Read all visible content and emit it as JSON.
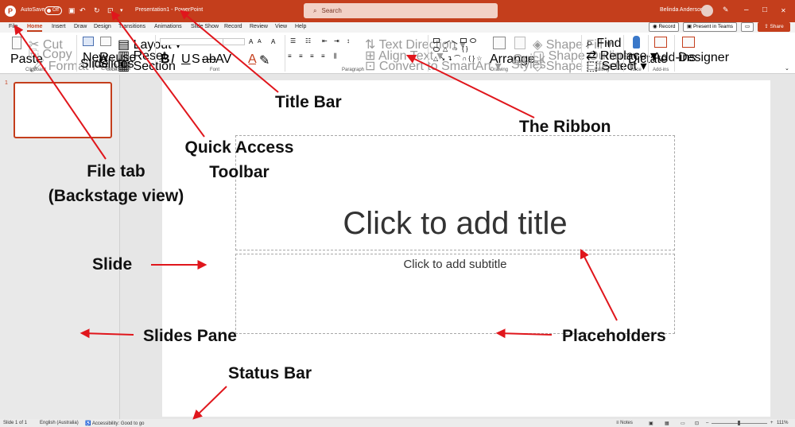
{
  "titlebar": {
    "logo": "P",
    "autosave_label": "AutoSave",
    "autosave_state": "Off",
    "qat": [
      "save-icon",
      "undo-icon",
      "redo-icon",
      "present-icon",
      "customize-icon"
    ],
    "doc_title": "Presentation1  -  PowerPoint",
    "search_placeholder": "Search",
    "user_name": "Belinda Anderson",
    "minimize": "–",
    "maximize": "□",
    "close": "✕"
  },
  "tabs": [
    "File",
    "Home",
    "Insert",
    "Draw",
    "Design",
    "Transitions",
    "Animations",
    "Slide Show",
    "Record",
    "Review",
    "View",
    "Help"
  ],
  "tab_right": {
    "record": "Record",
    "present": "Present in Teams",
    "share": "Share"
  },
  "ribbon": {
    "clipboard": {
      "group": "Clipboard",
      "paste": "Paste",
      "cut": "Cut",
      "copy": "Copy",
      "format_painter": "Format Painter"
    },
    "slides": {
      "group": "Slides",
      "new_slide_1": "New",
      "new_slide_2": "Slide",
      "reuse_1": "Reuse",
      "reuse_2": "Slides",
      "layout": "Layout",
      "reset": "Reset",
      "section": "Section"
    },
    "font": {
      "group": "Font",
      "bold": "B",
      "italic": "I",
      "underline": "U",
      "strike": "S",
      "shadow": "ab",
      "spacing": "AV",
      "grow": "A",
      "shrink": "A",
      "clear": "A"
    },
    "paragraph": {
      "group": "Paragraph",
      "text_direction": "Text Direction",
      "align_text": "Align Text",
      "smartart": "Convert to SmartArt"
    },
    "drawing": {
      "group": "Drawing",
      "arrange": "Arrange",
      "quick_styles_1": "Quick",
      "quick_styles_2": "Styles",
      "shape_fill": "Shape Fill",
      "shape_outline": "Shape Outline",
      "shape_effects": "Shape Effects"
    },
    "editing": {
      "group": "Editing",
      "find": "Find",
      "replace": "Replace",
      "select": "Select"
    },
    "voice": {
      "group": "Voice",
      "dictate": "Dictate"
    },
    "addins": {
      "group": "Add-ins",
      "addins": "Add-ins"
    },
    "designer": {
      "designer": "Designer"
    }
  },
  "slides_pane": {
    "slide_number": "1"
  },
  "slide": {
    "title_placeholder": "Click to add title",
    "subtitle_placeholder": "Click to add subtitle"
  },
  "status": {
    "slide_count": "Slide 1 of 1",
    "language": "English (Australia)",
    "accessibility": "Accessibility: Good to go",
    "notes": "Notes",
    "zoom": "111%"
  },
  "annotations": {
    "title_bar": "Title Bar",
    "ribbon": "The Ribbon",
    "qat_1": "Quick Access",
    "qat_2": "Toolbar",
    "file_tab_1": "File tab",
    "file_tab_2": "(Backstage view)",
    "slide": "Slide",
    "slides_pane": "Slides Pane",
    "placeholders": "Placeholders",
    "status_bar": "Status Bar"
  },
  "colors": {
    "accent": "#c43e1c",
    "arrow": "#e0161c"
  }
}
